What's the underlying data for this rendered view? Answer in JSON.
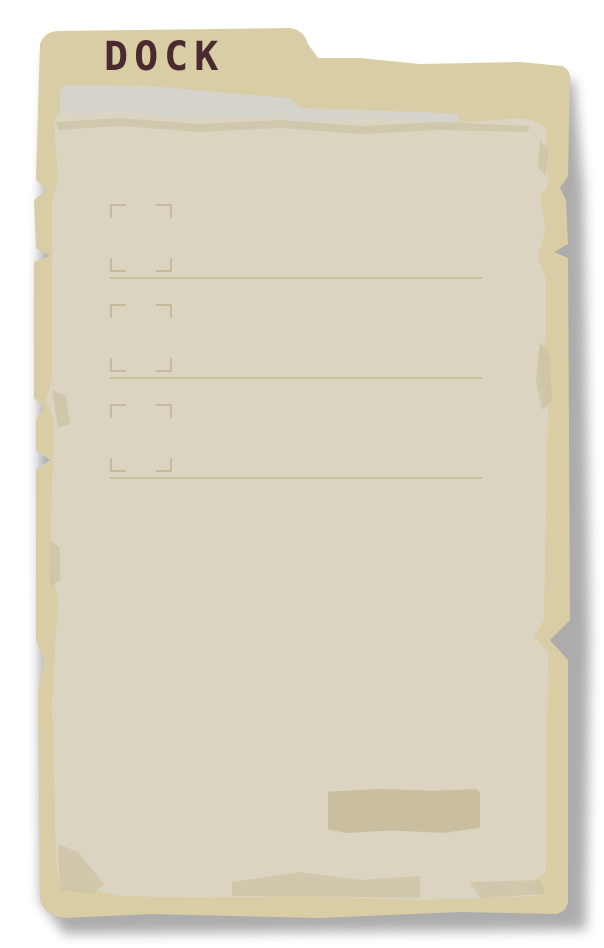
{
  "folder": {
    "tab_label": "DOCK"
  },
  "slots": [
    {
      "label": ""
    },
    {
      "label": ""
    },
    {
      "label": ""
    }
  ],
  "action_button": {
    "label": ""
  },
  "colors": {
    "page_background": "#ffffff",
    "folder_outer": "#d8cda4",
    "paper": "#dbd4c1",
    "paper_edge": "#ccc3a4",
    "tab_label": "#4a2a2e",
    "slot_lines": "#c9bfa1",
    "button": "#c9bfa0"
  }
}
